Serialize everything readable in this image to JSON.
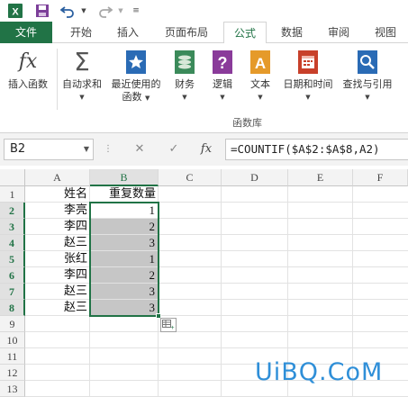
{
  "ribbon_tabs": {
    "file": "文件",
    "home": "开始",
    "insert": "插入",
    "page_layout": "页面布局",
    "formulas": "公式",
    "data": "数据",
    "review": "审阅",
    "view": "视图"
  },
  "ribbon": {
    "insert_function": "插入函数",
    "autosum": "自动求和",
    "recent_line1": "最近使用的",
    "recent_line2": "函数",
    "financial": "财务",
    "logical": "逻辑",
    "text": "文本",
    "datetime": "日期和时间",
    "lookup": "查找与引用",
    "group_label": "函数库",
    "fx_glyph": "fx"
  },
  "formula_bar": {
    "name_box": "B2",
    "formula": "=COUNTIF($A$2:$A$8,A2)",
    "cancel_glyph": "✕",
    "enter_glyph": "✓",
    "fx_glyph": "fx"
  },
  "grid": {
    "columns": [
      "A",
      "B",
      "C",
      "D",
      "E",
      "F"
    ],
    "rows": [
      "1",
      "2",
      "3",
      "4",
      "5",
      "6",
      "7",
      "8",
      "9",
      "10",
      "11",
      "12",
      "13"
    ],
    "header_a": "姓名",
    "header_b": "重复数量",
    "names": [
      "李亮",
      "李四",
      "赵三",
      "张红",
      "李四",
      "赵三",
      "赵三"
    ],
    "counts": [
      "1",
      "2",
      "3",
      "1",
      "2",
      "3",
      "3"
    ]
  },
  "colors": {
    "excel_green": "#217346",
    "selection_fill": "#c6c6c6",
    "watermark": "#2f8fd8"
  },
  "watermark": "UiBQ.CoM"
}
